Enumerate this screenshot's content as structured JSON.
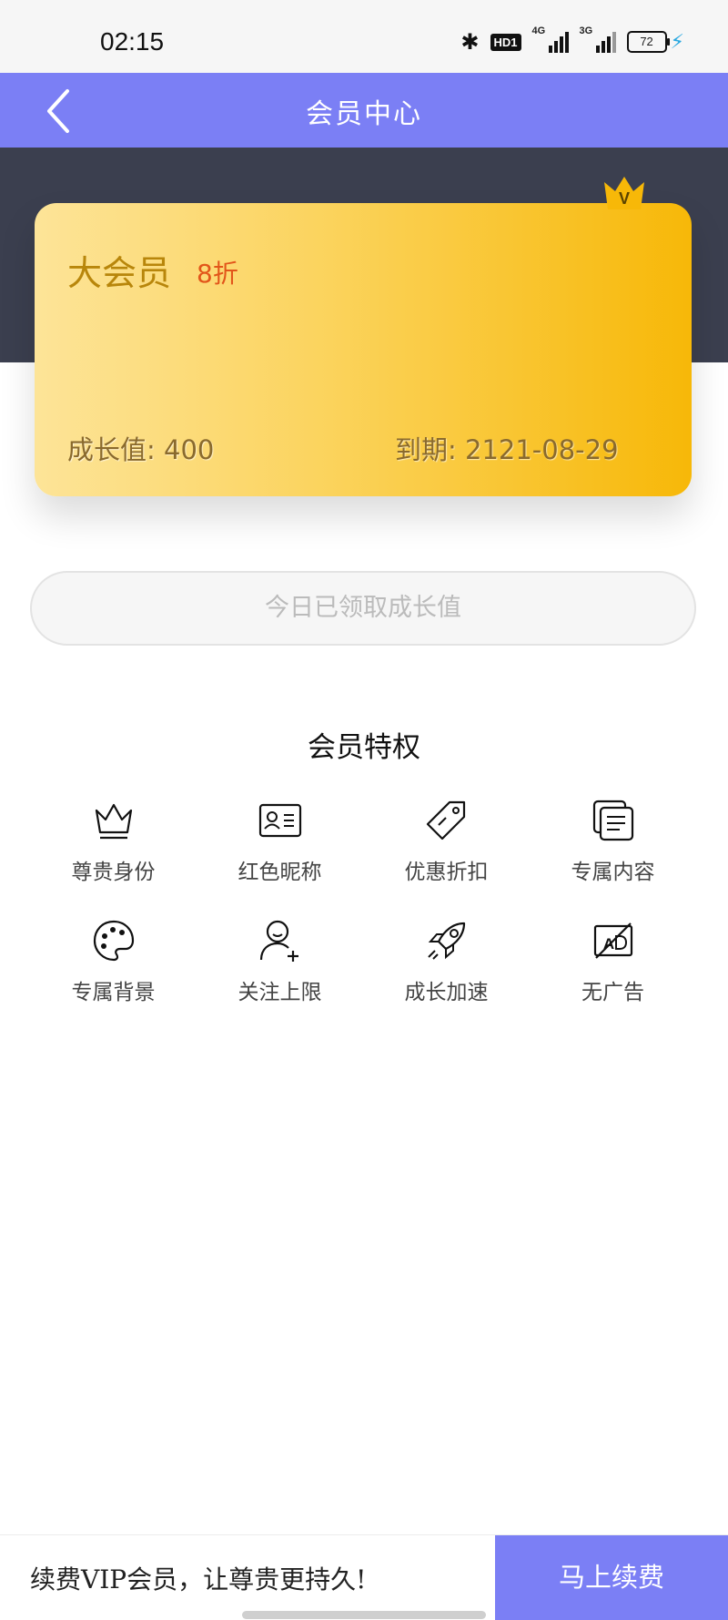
{
  "status_bar": {
    "time": "02:15",
    "bluetooth_icon": "bluetooth-icon",
    "hd_label": "HD1",
    "signal1_label": "4G",
    "signal2_label": "3G",
    "battery_level": "72",
    "charging_icon": "bolt-icon"
  },
  "nav": {
    "title": "会员中心",
    "back_icon": "chevron-left-icon"
  },
  "card": {
    "title": "大会员",
    "discount": "8折",
    "badge_letter": "V",
    "growth": "成长值: 400",
    "expire": "到期: 2121-08-29",
    "colors": {
      "gradient_start": "#fde498",
      "gradient_end": "#f7b808",
      "title": "#b8860b",
      "discount": "#e2551a"
    }
  },
  "claim_button": {
    "label": "今日已领取成长值"
  },
  "privileges": {
    "title": "会员特权",
    "items": [
      {
        "label": "尊贵身份",
        "icon": "crown-icon"
      },
      {
        "label": "红色昵称",
        "icon": "id-card-icon"
      },
      {
        "label": "优惠折扣",
        "icon": "tag-icon"
      },
      {
        "label": "专属内容",
        "icon": "documents-icon"
      },
      {
        "label": "专属背景",
        "icon": "palette-icon"
      },
      {
        "label": "关注上限",
        "icon": "user-add-icon"
      },
      {
        "label": "成长加速",
        "icon": "rocket-icon"
      },
      {
        "label": "无广告",
        "icon": "no-ad-icon"
      }
    ]
  },
  "bottom_bar": {
    "text": "续费VIP会员，让尊贵更持久!",
    "button": "马上续费"
  },
  "theme": {
    "accent": "#7b7ff5",
    "dark_band": "#3b3f4f"
  }
}
